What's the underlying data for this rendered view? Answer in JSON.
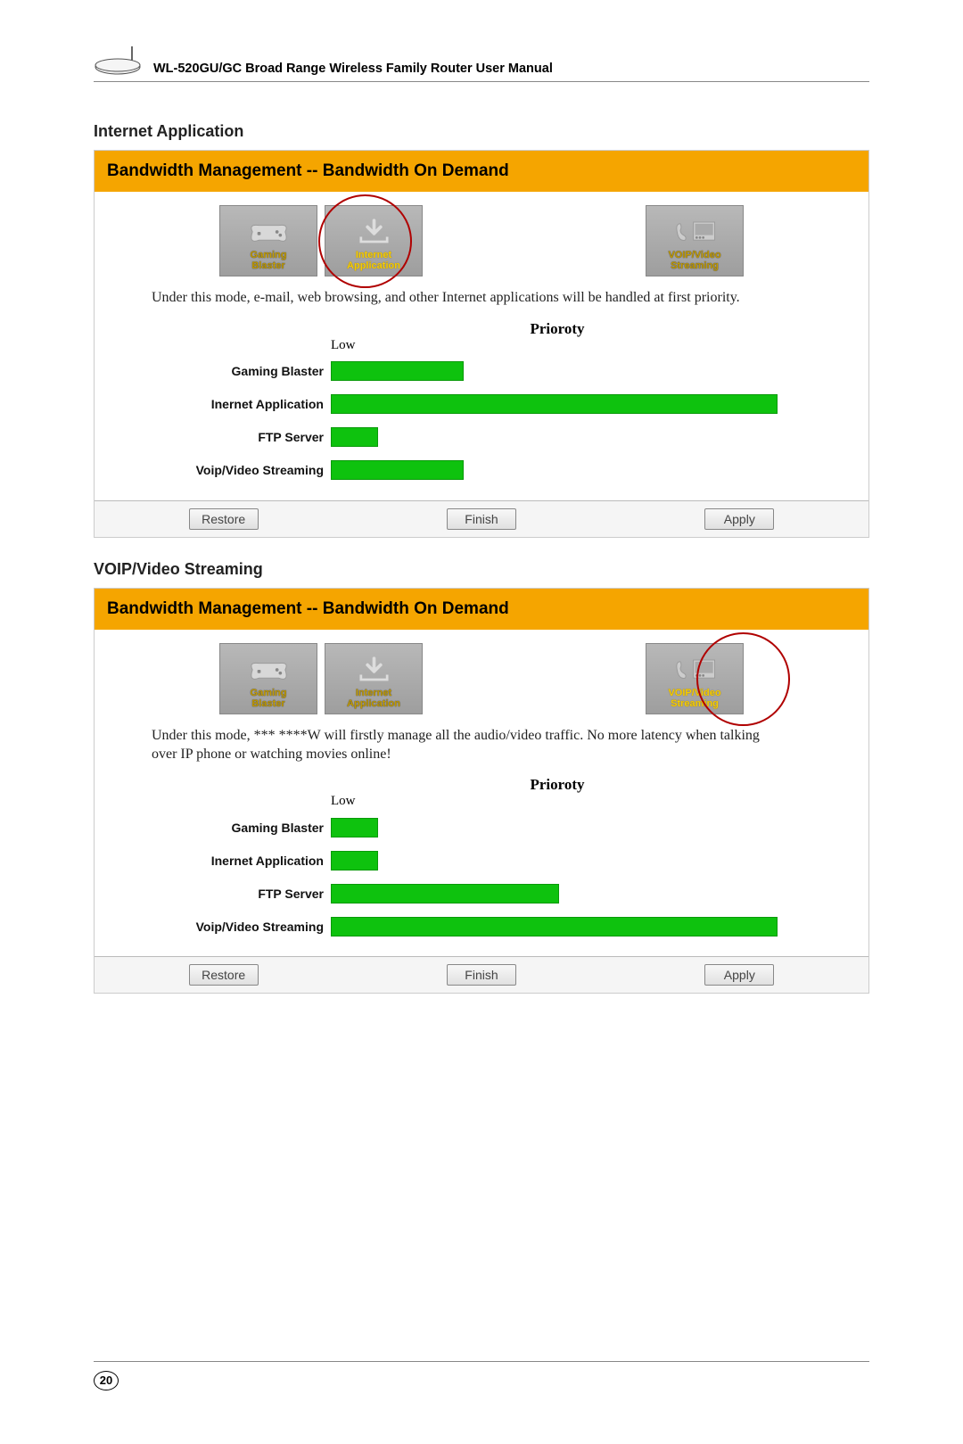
{
  "header": {
    "title": "WL-520GU/GC Broad Range Wireless Family Router User Manual"
  },
  "section1": {
    "title": "Internet Application",
    "panel_title": "Bandwidth Management -- Bandwidth On Demand",
    "modes": {
      "gaming": {
        "line1": "Gaming",
        "line2": "Blaster"
      },
      "internet": {
        "line1": "Internet",
        "line2": "Application"
      },
      "voip": {
        "line1": "VOIP/Video",
        "line2": "Streaming"
      }
    },
    "description": "Under this mode, e-mail, web browsing, and other Internet applications will be handled at first priority.",
    "priority_heading": "Prioroty",
    "low_label": "Low",
    "bars": [
      {
        "label": "Gaming Blaster",
        "width_pct": 28
      },
      {
        "label": "Inernet Application",
        "width_pct": 94
      },
      {
        "label": "FTP Server",
        "width_pct": 10
      },
      {
        "label": "Voip/Video Streaming",
        "width_pct": 28
      }
    ],
    "buttons": {
      "restore": "Restore",
      "finish": "Finish",
      "apply": "Apply"
    }
  },
  "section2": {
    "title": "VOIP/Video Streaming",
    "panel_title": "Bandwidth Management -- Bandwidth On Demand",
    "modes": {
      "gaming": {
        "line1": "Gaming",
        "line2": "Blaster"
      },
      "internet": {
        "line1": "Internet",
        "line2": "Application"
      },
      "voip": {
        "line1": "VOIP/Video",
        "line2": "Streaming"
      }
    },
    "description": "Under this mode, *** ****W will firstly manage all the audio/video traffic. No more latency when talking over IP phone or watching movies online!",
    "priority_heading": "Prioroty",
    "low_label": "Low",
    "bars": [
      {
        "label": "Gaming Blaster",
        "width_pct": 10
      },
      {
        "label": "Inernet Application",
        "width_pct": 10
      },
      {
        "label": "FTP Server",
        "width_pct": 48
      },
      {
        "label": "Voip/Video Streaming",
        "width_pct": 94
      }
    ],
    "buttons": {
      "restore": "Restore",
      "finish": "Finish",
      "apply": "Apply"
    }
  },
  "page_number": "20",
  "chart_data": [
    {
      "type": "bar",
      "title": "Prioroty",
      "context": "Internet Application mode",
      "xlabel": "Low",
      "categories": [
        "Gaming Blaster",
        "Inernet Application",
        "FTP Server",
        "Voip/Video Streaming"
      ],
      "values": [
        28,
        94,
        10,
        28
      ]
    },
    {
      "type": "bar",
      "title": "Prioroty",
      "context": "VOIP/Video Streaming mode",
      "xlabel": "Low",
      "categories": [
        "Gaming Blaster",
        "Inernet Application",
        "FTP Server",
        "Voip/Video Streaming"
      ],
      "values": [
        10,
        10,
        48,
        94
      ]
    }
  ]
}
